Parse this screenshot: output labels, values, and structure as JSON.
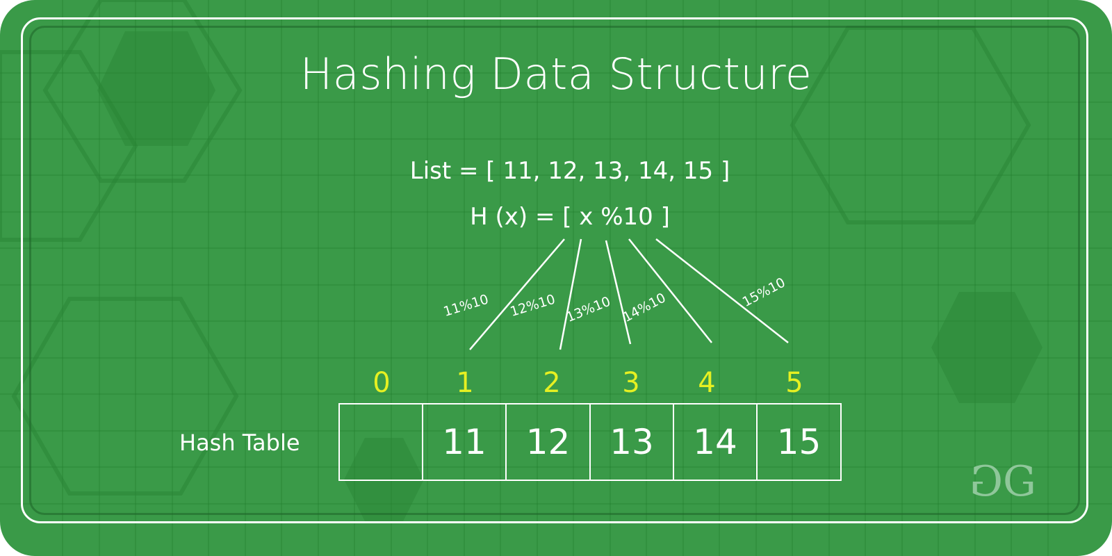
{
  "title": "Hashing Data Structure",
  "list_text": "List = [ 11, 12, 13, 14, 15 ]",
  "hash_function_text": "H (x) = [ x %10 ]",
  "list_values": [
    11,
    12,
    13,
    14,
    15
  ],
  "modulus": 10,
  "edge_labels": [
    "11%10",
    "12%10",
    "13%10",
    "14%10",
    "15%10"
  ],
  "hash_table": {
    "label": "Hash Table",
    "indices": [
      "0",
      "1",
      "2",
      "3",
      "4",
      "5"
    ],
    "cells": [
      "",
      "11",
      "12",
      "13",
      "14",
      "15"
    ]
  },
  "logo": {
    "name": "GeeksforGeeks logo",
    "left_glyph": "G",
    "right_glyph": "G"
  },
  "colors": {
    "background": "#3a9a48",
    "text": "#ffffff",
    "index_text": "#e6f022",
    "logo": "#8fc79a"
  }
}
